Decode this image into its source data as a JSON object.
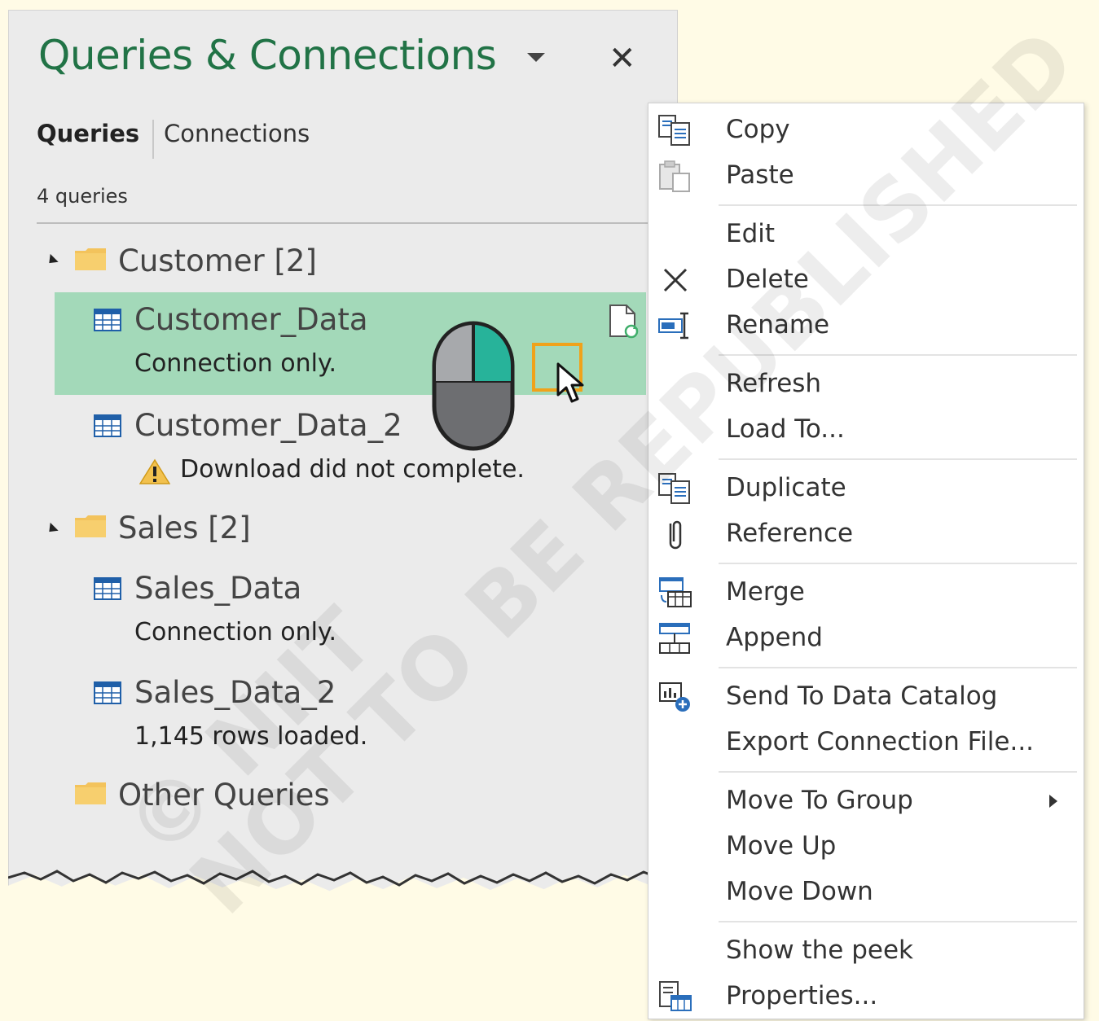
{
  "pane": {
    "title": "Queries & Connections",
    "tabs": [
      "Queries",
      "Connections"
    ],
    "count_label": "4 queries",
    "groups": [
      {
        "label": "Customer [2]",
        "queries": [
          {
            "name": "Customer_Data",
            "status": "Connection only.",
            "selected": true
          },
          {
            "name": "Customer_Data_2",
            "status": "Download did not complete.",
            "warning": true
          }
        ]
      },
      {
        "label": "Sales [2]",
        "queries": [
          {
            "name": "Sales_Data",
            "status": "Connection only."
          },
          {
            "name": "Sales_Data_2",
            "status": "1,145 rows loaded."
          }
        ]
      },
      {
        "label": "Other Queries",
        "queries": []
      }
    ],
    "selected_color": "#a3d9b9",
    "title_color": "#217346"
  },
  "menu": {
    "items": [
      {
        "label": "Copy",
        "icon": "copy-icon"
      },
      {
        "label": "Paste",
        "icon": "paste-icon"
      },
      {
        "label": "Edit",
        "icon": ""
      },
      {
        "label": "Delete",
        "icon": "delete-icon"
      },
      {
        "label": "Rename",
        "icon": "rename-icon"
      },
      {
        "label": "Refresh",
        "icon": ""
      },
      {
        "label": "Load To...",
        "icon": ""
      },
      {
        "label": "Duplicate",
        "icon": "duplicate-icon"
      },
      {
        "label": "Reference",
        "icon": "paperclip-icon"
      },
      {
        "label": "Merge",
        "icon": "merge-icon"
      },
      {
        "label": "Append",
        "icon": "append-icon"
      },
      {
        "label": "Send To Data Catalog",
        "icon": "data-catalog-icon"
      },
      {
        "label": "Export Connection File...",
        "icon": ""
      },
      {
        "label": "Move To Group",
        "icon": "",
        "submenu": true
      },
      {
        "label": "Move Up",
        "icon": ""
      },
      {
        "label": "Move Down",
        "icon": ""
      },
      {
        "label": "Show the peek",
        "icon": ""
      },
      {
        "label": "Properties...",
        "icon": "properties-icon"
      }
    ]
  },
  "watermark": {
    "line1": "NOT TO BE REPUBLISHED",
    "line2": "© NIIT"
  }
}
